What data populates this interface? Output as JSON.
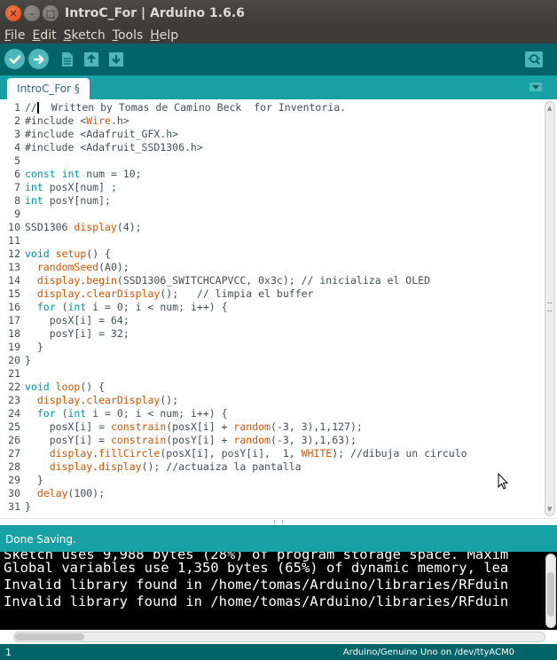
{
  "window": {
    "title": "IntroC_For | Arduino 1.6.6",
    "close_glyph": "✕",
    "minimize_glyph": "–",
    "maximize_glyph": "□"
  },
  "menu": [
    {
      "underlined": "F",
      "rest": "ile"
    },
    {
      "underlined": "E",
      "rest": "dit"
    },
    {
      "underlined": "S",
      "rest": "ketch"
    },
    {
      "underlined": "T",
      "rest": "ools"
    },
    {
      "underlined": "H",
      "rest": "elp"
    }
  ],
  "toolbar": {
    "icons": [
      "verify-icon",
      "upload-icon",
      "new-icon",
      "open-icon",
      "save-icon",
      "serial-monitor-icon"
    ]
  },
  "tabs": {
    "active_label": "IntroC_For §",
    "menu_icon": "triangle-down-icon"
  },
  "editor": {
    "line_numbers": [
      "1",
      "2",
      "3",
      "4",
      "5",
      "6",
      "7",
      "8",
      "9",
      "10",
      "11",
      "12",
      "13",
      "14",
      "15",
      "16",
      "17",
      "18",
      "19",
      "20",
      "21",
      "22",
      "23",
      "24",
      "25",
      "26",
      "27",
      "28",
      "29",
      "30",
      "31"
    ],
    "lines": [
      "//  Written by Tomas de Camino Beck  for Inventoria.",
      "#include <Wire.h>",
      "#include <Adafruit_GFX.h>",
      "#include <Adafruit_SSD1306.h>",
      "",
      "const int num = 10;",
      "int posX[num] ;",
      "int posY[num];",
      "",
      "SSD1306 display(4);",
      "",
      "void setup() {",
      "  randomSeed(A0);",
      "  display.begin(SSD1306_SWITCHCAPVCC, 0x3c); // inicializa el OLED",
      "  display.clearDisplay();   // limpia el buffer",
      "  for (int i = 0; i < num; i++) {",
      "    posX[i] = 64;",
      "    posY[i] = 32;",
      "  }",
      "}",
      "",
      "void loop() {",
      "  display.clearDisplay();",
      "  for (int i = 0; i < num; i++) {",
      "    posX[i] = constrain(posX[i] + random(-3, 3),1,127);",
      "    posY[i] = constrain(posY[i] + random(-3, 3),1,63);",
      "    display.fillCircle(posX[i], posY[i],  1, WHITE); //dibuja un circulo",
      "    display.display(); //actuaiza la pantalla",
      "  }",
      "  delay(100);",
      "}"
    ]
  },
  "status": {
    "message": "Done Saving."
  },
  "console": {
    "lines": [
      "Sketch uses 9,988 bytes (28%) of program storage space. Maxim",
      "Global variables use 1,350 bytes (65%) of dynamic memory, lea",
      "Invalid library found in /home/tomas/Arduino/libraries/RFduin",
      "Invalid library found in /home/tomas/Arduino/libraries/RFduin"
    ]
  },
  "footer": {
    "line": "1",
    "board": "Arduino/Genuino Uno on /dev/ttyACM0"
  },
  "colors": {
    "toolbar": "#006468",
    "tabbar": "#17a1a5",
    "keyword": "#00979c",
    "function": "#d35400"
  }
}
